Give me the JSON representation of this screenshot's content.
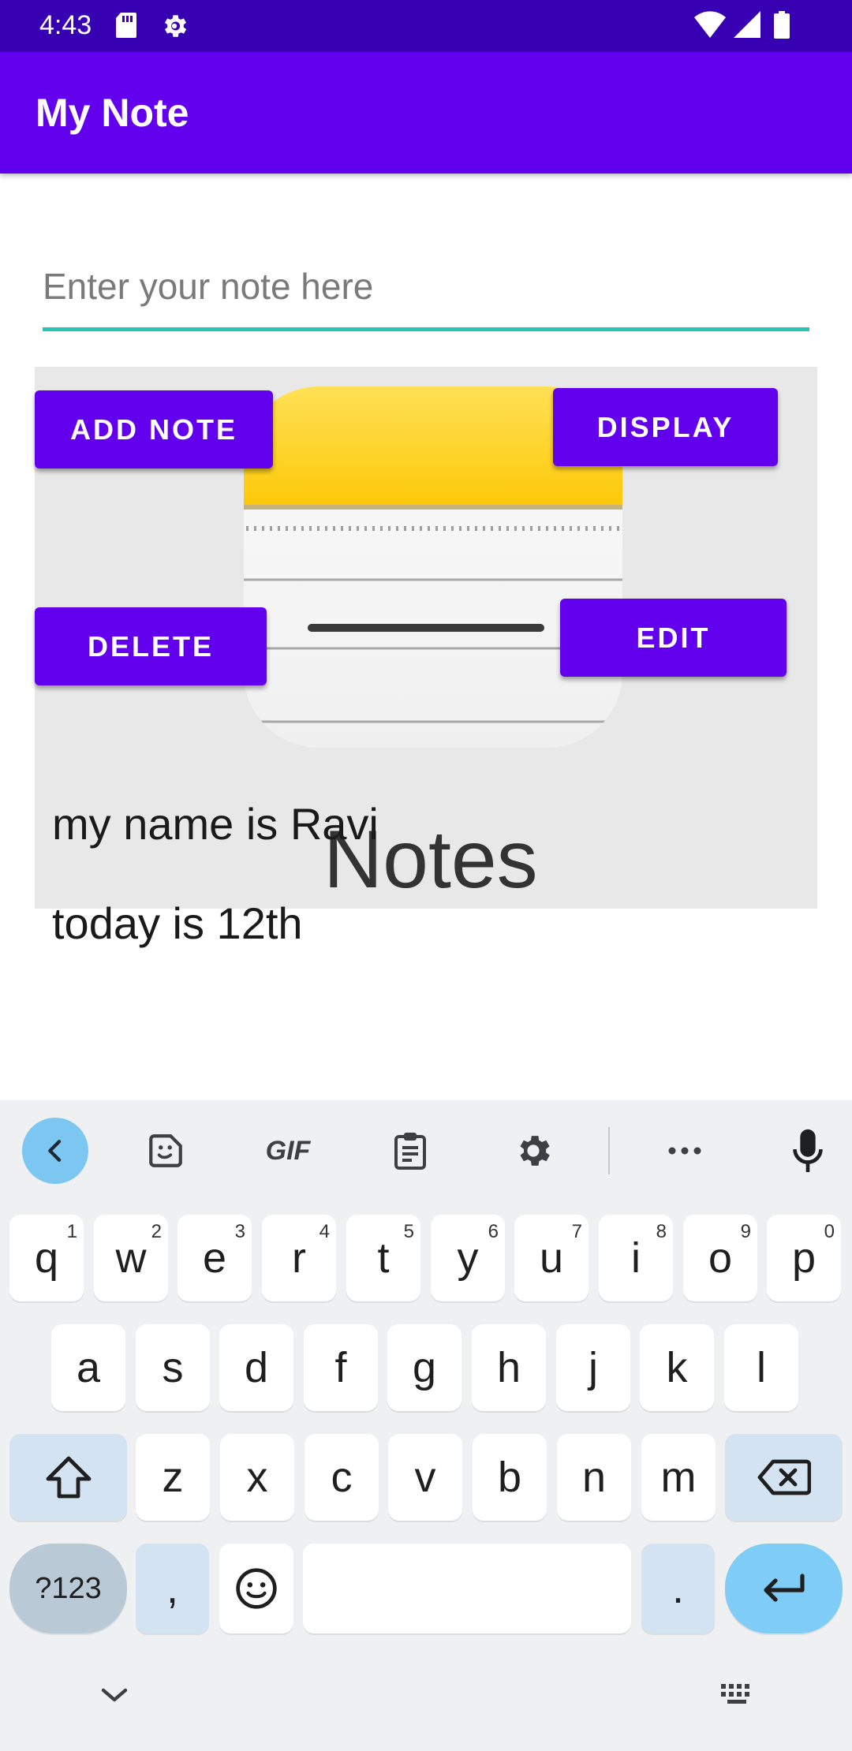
{
  "status_bar": {
    "time": "4:43",
    "icons": [
      "sd-card-icon",
      "settings-icon",
      "wifi-icon",
      "signal-icon",
      "battery-icon"
    ]
  },
  "app_bar": {
    "title": "My Note"
  },
  "note_input": {
    "value": "",
    "placeholder": "Enter your note here"
  },
  "buttons": {
    "add_note": "ADD NOTE",
    "display": "DISPLAY",
    "delete": "DELETE",
    "edit": "EDIT"
  },
  "image": {
    "caption": "Notes"
  },
  "notes": [
    "my name is Ravi",
    "today is 12th"
  ],
  "keyboard": {
    "toolbar": [
      "back-arrow-icon",
      "sticker-icon",
      "gif-icon",
      "clipboard-icon",
      "settings-icon",
      "more-icon",
      "microphone-icon"
    ],
    "gif_label": "GIF",
    "rows": [
      [
        {
          "label": "q",
          "hint": "1"
        },
        {
          "label": "w",
          "hint": "2"
        },
        {
          "label": "e",
          "hint": "3"
        },
        {
          "label": "r",
          "hint": "4"
        },
        {
          "label": "t",
          "hint": "5"
        },
        {
          "label": "y",
          "hint": "6"
        },
        {
          "label": "u",
          "hint": "7"
        },
        {
          "label": "i",
          "hint": "8"
        },
        {
          "label": "o",
          "hint": "9"
        },
        {
          "label": "p",
          "hint": "0"
        }
      ],
      [
        {
          "label": "a"
        },
        {
          "label": "s"
        },
        {
          "label": "d"
        },
        {
          "label": "f"
        },
        {
          "label": "g"
        },
        {
          "label": "h"
        },
        {
          "label": "j"
        },
        {
          "label": "k"
        },
        {
          "label": "l"
        }
      ],
      [
        {
          "label": "z"
        },
        {
          "label": "x"
        },
        {
          "label": "c"
        },
        {
          "label": "v"
        },
        {
          "label": "b"
        },
        {
          "label": "n"
        },
        {
          "label": "m"
        }
      ]
    ],
    "symbols_label": "?123",
    "comma_label": ",",
    "period_label": "."
  },
  "colors": {
    "status_bar": "#3700b3",
    "primary": "#6200ee",
    "input_underline": "#26c6b6",
    "keyboard_bg": "#eef0f2",
    "key_accent": "#7fcdf6"
  }
}
